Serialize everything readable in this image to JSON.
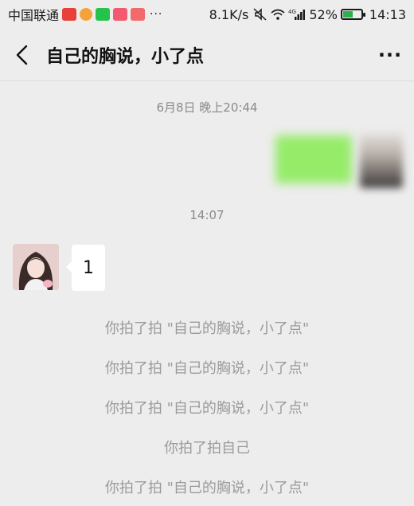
{
  "status_bar": {
    "carrier": "中国联通",
    "network_speed": "8.1K/s",
    "signal_type": "4G",
    "battery_percent": "52%",
    "time": "14:13",
    "ellipsis": "···"
  },
  "header": {
    "title": "自己的胸说，小了点",
    "more_label": "···"
  },
  "messages": {
    "timestamp_1": "6月8日 晚上20:44",
    "timestamp_2": "14:07",
    "incoming_text": "1"
  },
  "system_messages": [
    "你拍了拍 \"自己的胸说，小了点\"",
    "你拍了拍 \"自己的胸说，小了点\"",
    "你拍了拍 \"自己的胸说，小了点\"",
    "你拍了拍自己",
    "你拍了拍 \"自己的胸说，小了点\""
  ],
  "colors": {
    "background": "#ededed",
    "outgoing_bubble": "#95ec69",
    "incoming_bubble": "#ffffff",
    "system_text": "#9b9b9b"
  }
}
